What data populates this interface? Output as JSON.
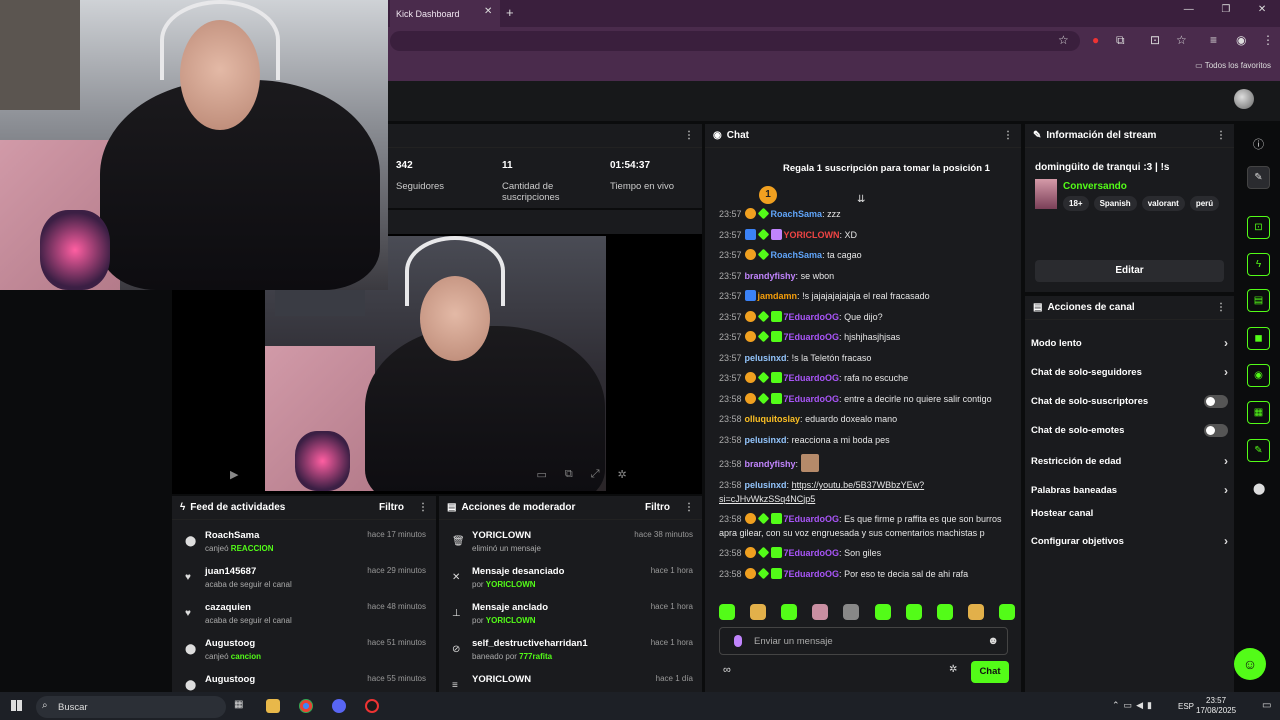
{
  "browser": {
    "tab_title": "Kick Dashboard",
    "favorites_label": "Todos los favoritos"
  },
  "stats": {
    "items": [
      {
        "value": "342",
        "label": "Seguidores"
      },
      {
        "value": "11",
        "label": "Cantidad de suscripciones"
      },
      {
        "value": "01:54:37",
        "label": "Tiempo en vivo"
      }
    ]
  },
  "chat": {
    "title": "Chat",
    "pinned_rank": "1",
    "pinned_text": "Regala 1 suscripción para tomar la posición 1",
    "messages": [
      {
        "time": "23:57",
        "badges": [
          "sub",
          "gem"
        ],
        "user": "RoachSama",
        "color": "#60a5fa",
        "text": "zzz"
      },
      {
        "time": "23:57",
        "badges": [
          "vip",
          "gem",
          "pur"
        ],
        "user": "YORICLOWN",
        "color": "#ef4444",
        "text": "XD"
      },
      {
        "time": "23:57",
        "badges": [
          "sub",
          "gem"
        ],
        "user": "RoachSama",
        "color": "#60a5fa",
        "text": "ta cagao"
      },
      {
        "time": "23:57",
        "badges": [],
        "user": "brandyfishy",
        "color": "#c084fc",
        "text": "se wbon"
      },
      {
        "time": "23:57",
        "badges": [
          "vip"
        ],
        "user": "jamdamn",
        "color": "#f59e0b",
        "text": "!s jajajajajajaja el real fracasado"
      },
      {
        "time": "23:57",
        "badges": [
          "sub",
          "gem",
          "mod"
        ],
        "user": "7EduardoOG",
        "color": "#a855f7",
        "text": "Que dijo?"
      },
      {
        "time": "23:57",
        "badges": [
          "sub",
          "gem",
          "mod"
        ],
        "user": "7EduardoOG",
        "color": "#a855f7",
        "text": "hjshjhasjhjsas"
      },
      {
        "time": "23:57",
        "badges": [],
        "user": "pelusinxd",
        "color": "#93c5fd",
        "text": "!s la Teletón fracaso"
      },
      {
        "time": "23:57",
        "badges": [
          "sub",
          "gem",
          "mod"
        ],
        "user": "7EduardoOG",
        "color": "#a855f7",
        "text": "rafa no escuche"
      },
      {
        "time": "23:58",
        "badges": [
          "sub",
          "gem",
          "mod"
        ],
        "user": "7EduardoOG",
        "color": "#a855f7",
        "text": "entre a decirle no quiere salir contigo"
      },
      {
        "time": "23:58",
        "badges": [],
        "user": "olluquitoslay",
        "color": "#fbbf24",
        "text": "eduardo doxealo mano"
      },
      {
        "time": "23:58",
        "badges": [],
        "user": "pelusinxd",
        "color": "#93c5fd",
        "text": "reacciona a mi boda pes"
      },
      {
        "time": "23:58",
        "badges": [],
        "user": "brandyfishy",
        "color": "#c084fc",
        "text": ""
      },
      {
        "time": "23:58",
        "badges": [],
        "user": "pelusinxd",
        "color": "#93c5fd",
        "text": "https://youtu.be/5B37WBbzYEw?si=cJHvWkzSSq4NCjp5",
        "link": true
      },
      {
        "time": "23:58",
        "badges": [
          "sub",
          "gem",
          "mod"
        ],
        "user": "7EduardoOG",
        "color": "#a855f7",
        "text": "Es que firme p raffita es que son burros apra gilear, con su voz engruesada y sus comentarios machistas p"
      },
      {
        "time": "23:58",
        "badges": [
          "sub",
          "gem",
          "mod"
        ],
        "user": "7EduardoOG",
        "color": "#a855f7",
        "text": "Son giles"
      },
      {
        "time": "23:58",
        "badges": [
          "sub",
          "gem",
          "mod"
        ],
        "user": "7EduardoOG",
        "color": "#a855f7",
        "text": "Por eso te decia sal de ahi rafa"
      }
    ],
    "input_placeholder": "Enviar un mensaje",
    "send_label": "Chat"
  },
  "info": {
    "header": "Información del stream",
    "title": "domingüito de tranqui :3 | !s",
    "category": "Conversando",
    "tags": [
      "18+",
      "Spanish",
      "valorant",
      "perú"
    ],
    "edit_label": "Editar"
  },
  "actions": {
    "header": "Acciones de canal",
    "items": [
      {
        "label": "Modo lento",
        "kind": "chevron"
      },
      {
        "label": "Chat de solo-seguidores",
        "kind": "chevron"
      },
      {
        "label": "Chat de solo-suscriptores",
        "kind": "toggle"
      },
      {
        "label": "Chat de solo-emotes",
        "kind": "toggle"
      },
      {
        "label": "Restricción de edad",
        "kind": "chevron"
      },
      {
        "label": "Palabras baneadas",
        "kind": "chevron"
      },
      {
        "label": "Hostear canal",
        "kind": "none"
      },
      {
        "label": "Configurar objetivos",
        "kind": "chevron"
      }
    ]
  },
  "feed": {
    "title": "Feed de actividades",
    "filter": "Filtro",
    "rows": [
      {
        "icon": "tokens-icon",
        "glyph": "⬤",
        "name": "RoachSama",
        "prefix": "canjeó ",
        "highlight": "REACCION",
        "suffix": "",
        "time": "hace 17 minutos"
      },
      {
        "icon": "heart-icon",
        "glyph": "♥",
        "name": "juan145687",
        "prefix": "acaba de seguir el canal",
        "highlight": "",
        "suffix": "",
        "time": "hace 29 minutos"
      },
      {
        "icon": "heart-icon",
        "glyph": "♥",
        "name": "cazaquien",
        "prefix": "acaba de seguir el canal",
        "highlight": "",
        "suffix": "",
        "time": "hace 48 minutos"
      },
      {
        "icon": "tokens-icon",
        "glyph": "⬤",
        "name": "Augustoog",
        "prefix": "canjeó ",
        "highlight": "cancion",
        "suffix": "",
        "time": "hace 51 minutos"
      },
      {
        "icon": "tokens-icon",
        "glyph": "⬤",
        "name": "Augustoog",
        "prefix": "",
        "highlight": "",
        "suffix": "",
        "time": "hace 55 minutos"
      }
    ]
  },
  "mod": {
    "title": "Acciones de moderador",
    "filter": "Filtro",
    "rows": [
      {
        "icon": "trash-icon",
        "glyph": "🗑",
        "name": "YORICLOWN",
        "prefix": "eliminó un mensaje",
        "highlight": "",
        "time": "hace 38 minutos"
      },
      {
        "icon": "unpin-icon",
        "glyph": "✕",
        "name": "Mensaje desanciado",
        "prefix": "por ",
        "highlight": "YORICLOWN",
        "time": "hace 1 hora"
      },
      {
        "icon": "pin-icon",
        "glyph": "⊥",
        "name": "Mensaje anclado",
        "prefix": "por ",
        "highlight": "YORICLOWN",
        "time": "hace 1 hora"
      },
      {
        "icon": "ban-icon",
        "glyph": "⊘",
        "name": "self_destructiveharridan1",
        "prefix": "baneado por ",
        "highlight": "777rafita",
        "time": "hace 1 hora"
      },
      {
        "icon": "hat-icon",
        "glyph": "≡",
        "name": "YORICLOWN",
        "prefix": "",
        "highlight": "",
        "time": "hace 1 día"
      }
    ]
  },
  "taskbar": {
    "search": "Buscar",
    "lang": "ESP",
    "time": "23:57",
    "date": "17/08/2025"
  }
}
